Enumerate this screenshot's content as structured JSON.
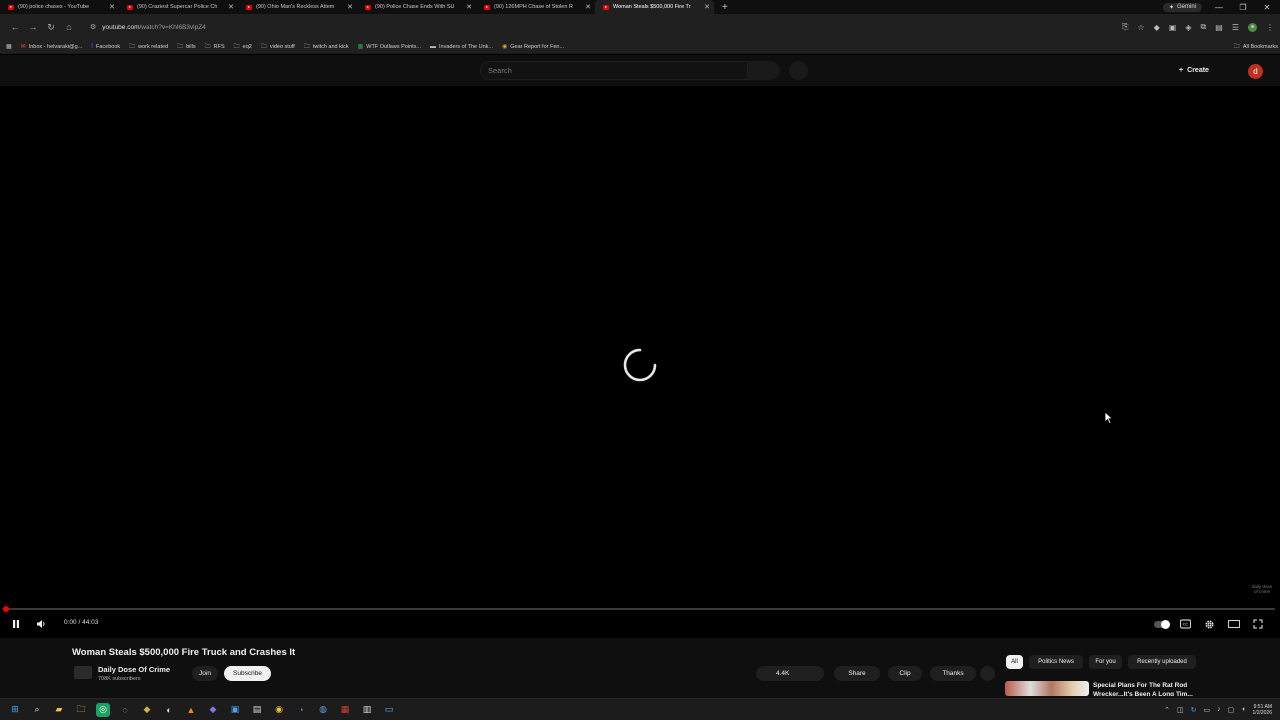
{
  "browser": {
    "tabs": [
      {
        "title": "(90) police chases - YouTube"
      },
      {
        "title": "(90) Craziest Supercar Police Ch"
      },
      {
        "title": "(90) Ohio Man's Reckless Attem"
      },
      {
        "title": "(90) Police Chase Ends With SU"
      },
      {
        "title": "(90) 126MPH Chase of Stolen R"
      },
      {
        "title": "Woman Steals $500,000 Fire Tr"
      }
    ],
    "gemini_label": "Gemini",
    "url_host": "youtube.com",
    "url_path": "/watch?v=Khl6B3vlpZ4",
    "bookmarks": [
      {
        "label": "Inbox - helvaraki@g..."
      },
      {
        "label": "Facebook"
      },
      {
        "label": "work related"
      },
      {
        "label": "bills"
      },
      {
        "label": "RFS"
      },
      {
        "label": "eq2"
      },
      {
        "label": "video stuff"
      },
      {
        "label": "twitch and kick"
      },
      {
        "label": "WTF Outlaws Points..."
      },
      {
        "label": "Invaders of The Unk..."
      },
      {
        "label": "Gear Report for Fen..."
      }
    ],
    "all_bookmarks_label": "All Bookmarks"
  },
  "youtube": {
    "search_placeholder": "Search",
    "create_label": "Create",
    "avatar_letter": "d"
  },
  "player": {
    "time_current": "0:00",
    "time_separator": " / ",
    "time_total": "44:03",
    "progress_fraction": 0.0,
    "watermark": "daily dose of crime"
  },
  "video": {
    "title": "Woman Steals $500,000 Fire Truck and Crashes It",
    "channel_name": "Daily Dose Of Crime",
    "subscribers": "708K subscribers",
    "join_label": "Join",
    "subscribe_label": "Subscribe",
    "likes": "4.4K",
    "share_label": "Share",
    "clip_label": "Clip",
    "thanks_label": "Thanks"
  },
  "sidebar": {
    "chips": [
      {
        "label": "All"
      },
      {
        "label": "Politics News"
      },
      {
        "label": "For you"
      },
      {
        "label": "Recently uploaded"
      }
    ],
    "first_rec_title": "Special Plans For The Rat Rod Wrecker...It's Been A Long Tim..."
  },
  "taskbar": {
    "clock_time": "9:51 AM",
    "clock_date": "1/2/2026"
  },
  "colors": {
    "accent_red": "#ff0000",
    "avatar_bg": "#c0311f",
    "page_bg": "#000000"
  }
}
